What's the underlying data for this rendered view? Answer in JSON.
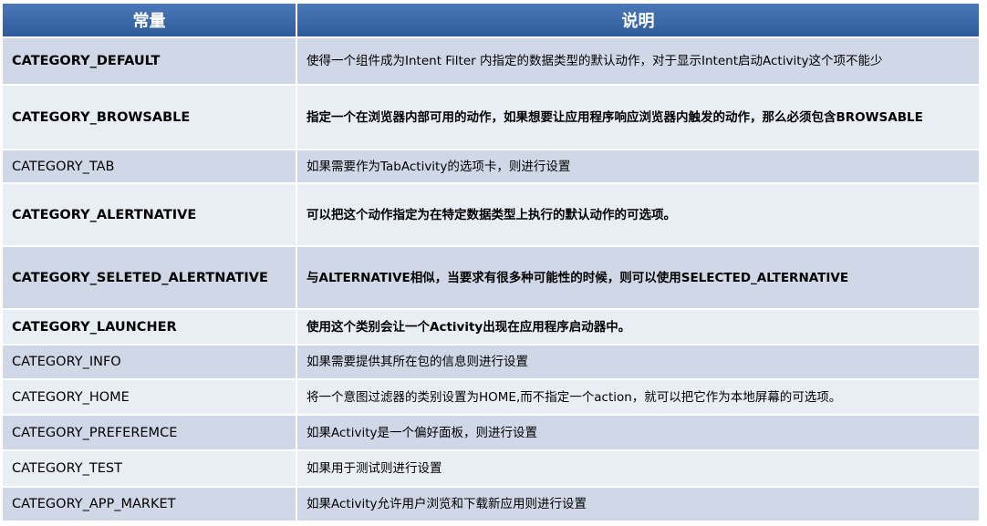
{
  "header": {
    "col1": "常量",
    "col2": "说明"
  },
  "rows": [
    {
      "name": "CATEGORY_DEFAULT",
      "desc": "使得一个组件成为Intent Filter 内指定的数据类型的默认动作，对于显示Intent启动Activity这个项不能少",
      "bold_name": true,
      "bold_desc": false
    },
    {
      "name": "CATEGORY_BROWSABLE",
      "desc": "指定一个在浏览器内部可用的动作，如果想要让应用程序响应浏览器内触发的动作，那么必须包含BROWSABLE",
      "bold_name": true,
      "bold_desc": true
    },
    {
      "name": "CATEGORY_TAB",
      "desc": "如果需要作为TabActivity的选项卡，则进行设置",
      "bold_name": false,
      "bold_desc": false
    },
    {
      "name": "CATEGORY_ALERTNATIVE",
      "desc": "可以把这个动作指定为在特定数据类型上执行的默认动作的可选项。",
      "bold_name": true,
      "bold_desc": true
    },
    {
      "name": "CATEGORY_SELETED_ALERTNATIVE",
      "desc": "与ALTERNATIVE相似，当要求有很多种可能性的时候，则可以使用SELECTED_ALTERNATIVE",
      "bold_name": true,
      "bold_desc": true
    },
    {
      "name": "CATEGORY_LAUNCHER",
      "desc": "使用这个类别会让一个Activity出现在应用程序启动器中。",
      "bold_name": true,
      "bold_desc": true
    },
    {
      "name": "CATEGORY_INFO",
      "desc": "如果需要提供其所在包的信息则进行设置",
      "bold_name": false,
      "bold_desc": false
    },
    {
      "name": "CATEGORY_HOME",
      "desc": "将一个意图过滤器的类别设置为HOME,而不指定一个action，就可以把它作为本地屏幕的可选项。",
      "bold_name": false,
      "bold_desc": false
    },
    {
      "name": "CATEGORY_PREFEREMCE",
      "desc": "如果Activity是一个偏好面板，则进行设置",
      "bold_name": false,
      "bold_desc": false
    },
    {
      "name": "CATEGORY_TEST",
      "desc": "如果用于测试则进行设置",
      "bold_name": false,
      "bold_desc": false
    },
    {
      "name": "CATEGORY_APP_MARKET",
      "desc": "如果Activity允许用户浏览和下载新应用则进行设置",
      "bold_name": false,
      "bold_desc": false
    }
  ],
  "colors": {
    "header_bg": "#3b68a8",
    "row_odd": "#d0d8e8",
    "row_even": "#e9edf4"
  }
}
